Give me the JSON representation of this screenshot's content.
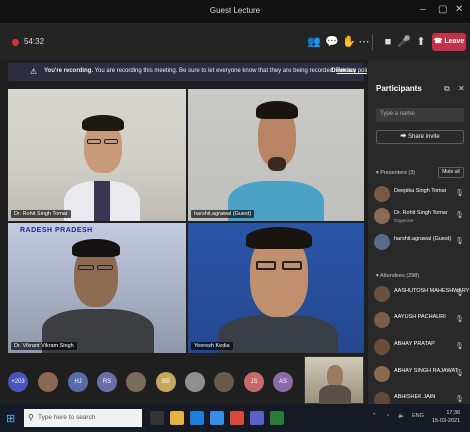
{
  "window": {
    "title": "Guest Lecture"
  },
  "meeting": {
    "elapsed": "54:32",
    "leave_label": "Leave"
  },
  "banner": {
    "lead": "You're recording.",
    "body": "You are recording this meeting. Be sure to let everyone know that they are being recorded.",
    "link": "Privacy policy",
    "dismiss": "Dismiss"
  },
  "tiles": [
    {
      "name": "Dr. Rohit Singh Tomar"
    },
    {
      "name": "harshit.agrawal (Guest)"
    },
    {
      "name": "Dr. Vikrant Vikram Singh",
      "backdrop_text": "RADESH PRADESH"
    },
    {
      "name": "Yeeresh Kedia"
    }
  ],
  "avatar_row": [
    {
      "label": "+203",
      "color": "#4b53bc"
    },
    {
      "label": "",
      "color": "#8a6b52"
    },
    {
      "label": "HJ",
      "color": "#5b6aa8"
    },
    {
      "label": "RS",
      "color": "#6b6fa8"
    },
    {
      "label": "",
      "color": "#7a6a5a"
    },
    {
      "label": "BB",
      "color": "#c7a75b"
    },
    {
      "label": "",
      "color": "#8f8f8f"
    },
    {
      "label": "",
      "color": "#6a5a4a"
    },
    {
      "label": "JS",
      "color": "#c46a6a"
    },
    {
      "label": "AS",
      "color": "#8a6aa8"
    }
  ],
  "participants": {
    "title": "Participants",
    "search_placeholder": "Type a name",
    "share_invite": "Share invite",
    "presenters_label": "Presenters (3)",
    "mute_all": "Mute all",
    "presenters": [
      {
        "name": "Deepika Singh Tomar",
        "role": ""
      },
      {
        "name": "Dr. Rohit Singh Tomar",
        "role": "Organizer"
      },
      {
        "name": "harshit.agrawal (Guest)",
        "role": ""
      }
    ],
    "attendees_label": "Attendees (298)",
    "attendees": [
      {
        "name": "AASHUTOSH MAHESHWARY"
      },
      {
        "name": "AAYUSH PACHAURI"
      },
      {
        "name": "ABHAY PRATAP"
      },
      {
        "name": "ABHAY SINGH RAJAWAT"
      },
      {
        "name": "ABHISHEK JAIN"
      }
    ]
  },
  "taskbar": {
    "search_placeholder": "Type here to search",
    "lang": "ENG",
    "time": "17:36",
    "date": "15-03-2021"
  }
}
